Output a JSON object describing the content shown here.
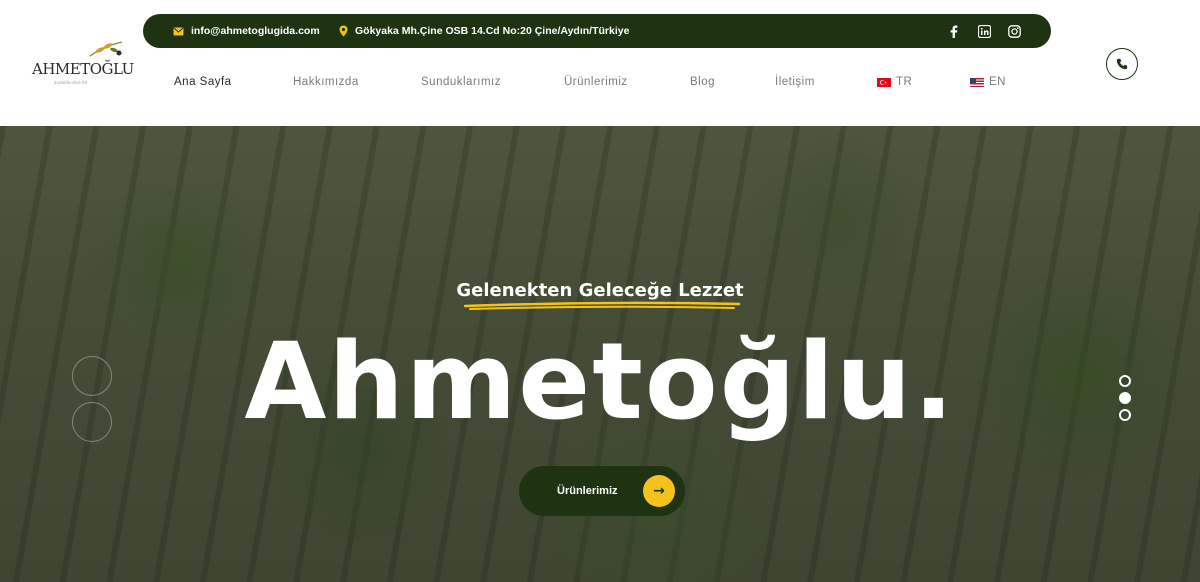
{
  "brand": {
    "logo_text": "AHMETOĞLU",
    "logo_sub": "anatolia olive ltd"
  },
  "topbar": {
    "email": "info@ahmetoglugida.com",
    "address": "Gökyaka Mh.Çine OSB 14.Cd No:20 Çine/Aydın/Türkiye",
    "social_icons": [
      "facebook-icon",
      "linkedin-icon",
      "instagram-icon"
    ]
  },
  "nav": {
    "items": [
      {
        "label": "Ana Sayfa",
        "active": true
      },
      {
        "label": "Hakkımızda"
      },
      {
        "label": "Sunduklarımız"
      },
      {
        "label": "Ürünlerimiz"
      },
      {
        "label": "Blog"
      },
      {
        "label": "İletişim"
      }
    ],
    "lang_tr": "TR",
    "lang_en": "EN"
  },
  "hero": {
    "tagline": "Gelenekten Geleceğe Lezzet",
    "title": "Ahmetoğlu.",
    "cta_label": "Ürünlerimiz",
    "cta_arrow": "→",
    "slide_count": 3,
    "active_slide": 2
  },
  "colors": {
    "brand_dark_green": "#1d3311",
    "accent_yellow": "#f4c21a"
  }
}
